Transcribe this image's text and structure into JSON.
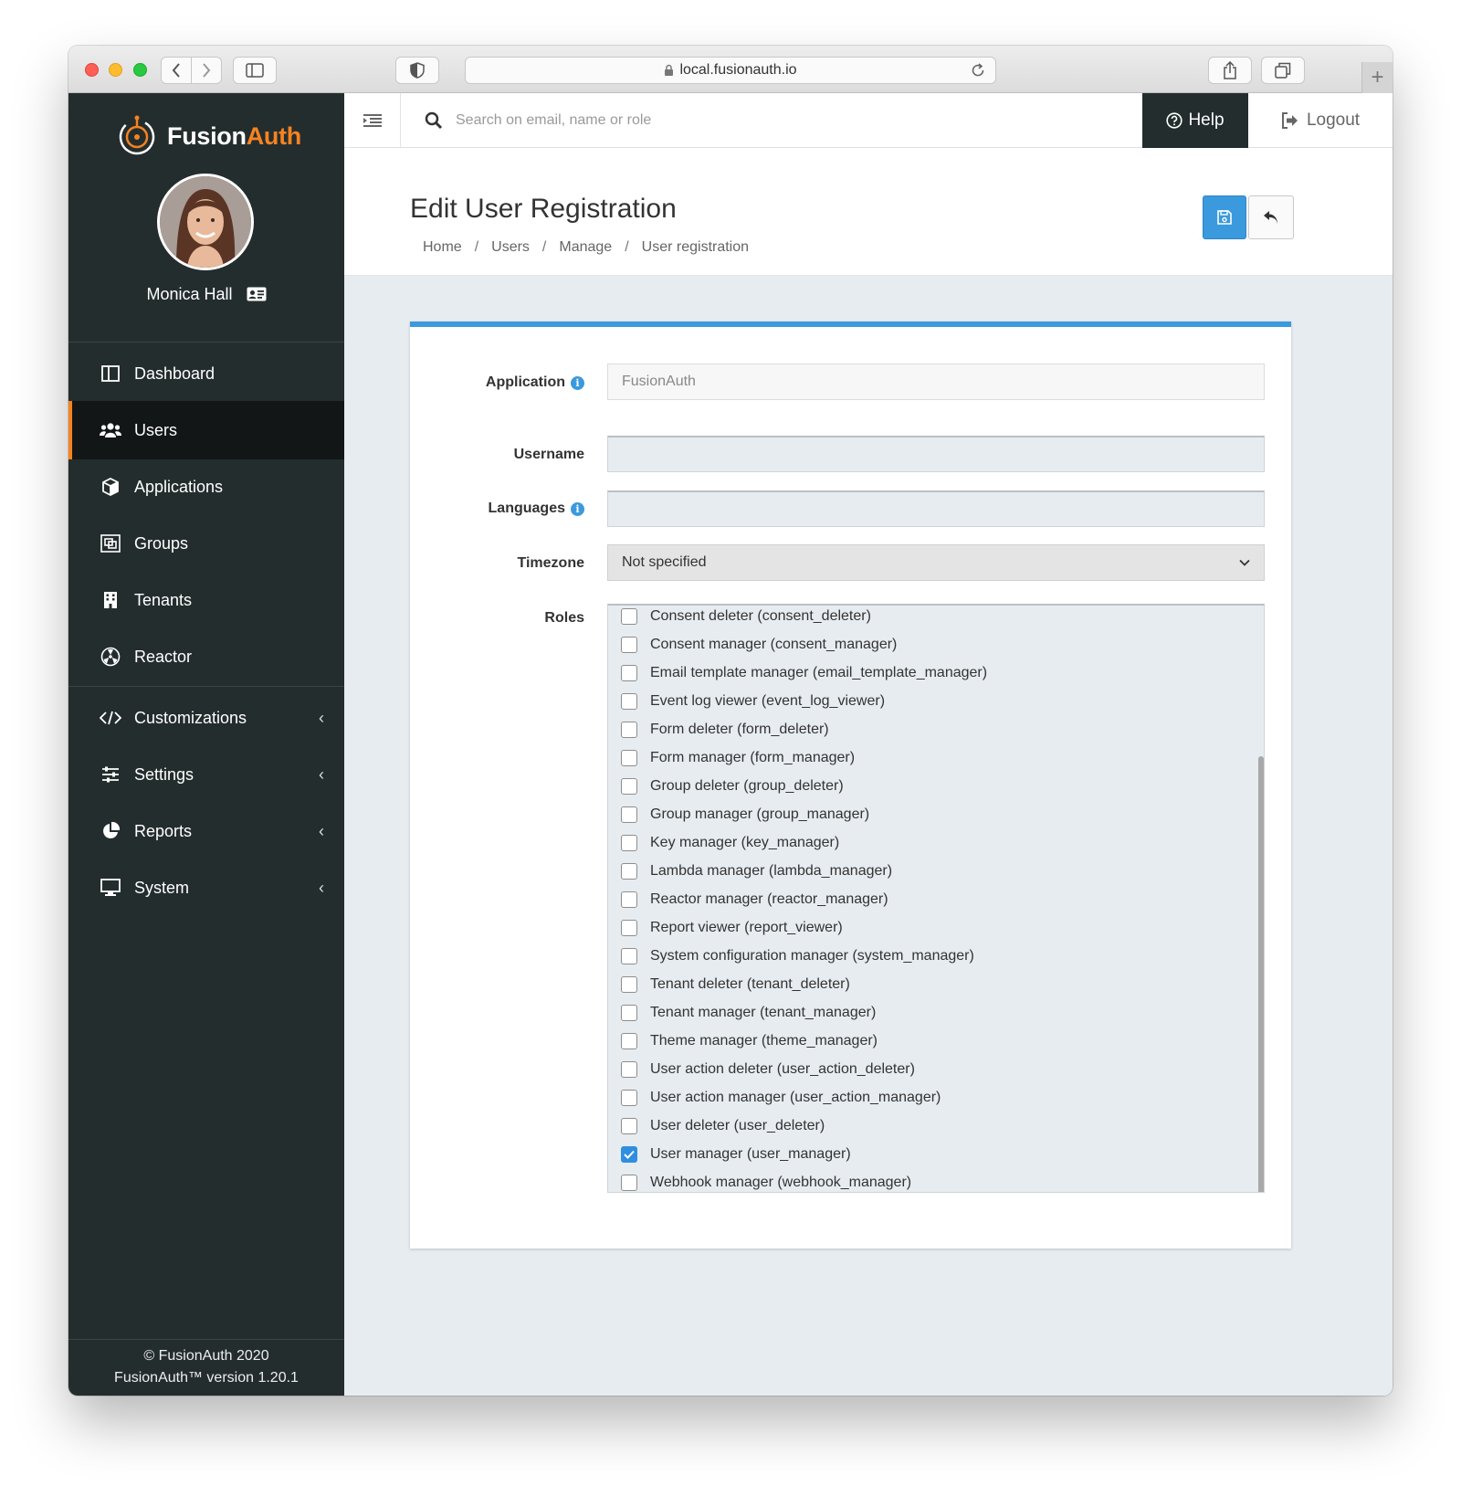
{
  "browser": {
    "url": "local.fusionauth.io"
  },
  "sidebar": {
    "brand_part1": "Fusion",
    "brand_part2": "Auth",
    "user_name": "Monica Hall",
    "items": [
      {
        "label": "Dashboard",
        "icon": "dashboard-icon"
      },
      {
        "label": "Users",
        "icon": "users-icon",
        "active": true
      },
      {
        "label": "Applications",
        "icon": "cube-icon"
      },
      {
        "label": "Groups",
        "icon": "groups-icon"
      },
      {
        "label": "Tenants",
        "icon": "building-icon"
      },
      {
        "label": "Reactor",
        "icon": "reactor-icon"
      },
      {
        "label": "Customizations",
        "icon": "code-icon",
        "expandable": true
      },
      {
        "label": "Settings",
        "icon": "sliders-icon",
        "expandable": true
      },
      {
        "label": "Reports",
        "icon": "pie-chart-icon",
        "expandable": true
      },
      {
        "label": "System",
        "icon": "desktop-icon",
        "expandable": true
      }
    ],
    "footer_line1": "© FusionAuth 2020",
    "footer_line2": "FusionAuth™ version 1.20.1"
  },
  "topbar": {
    "search_placeholder": "Search on email, name or role",
    "help_label": "Help",
    "logout_label": "Logout"
  },
  "header": {
    "title": "Edit User Registration",
    "breadcrumb": [
      "Home",
      "Users",
      "Manage",
      "User registration"
    ]
  },
  "form": {
    "application_label": "Application",
    "application_value": "FusionAuth",
    "username_label": "Username",
    "username_value": "",
    "languages_label": "Languages",
    "languages_value": "",
    "timezone_label": "Timezone",
    "timezone_value": "Not specified",
    "roles_label": "Roles",
    "roles": [
      {
        "label": "Consent deleter (consent_deleter)",
        "checked": false
      },
      {
        "label": "Consent manager (consent_manager)",
        "checked": false
      },
      {
        "label": "Email template manager (email_template_manager)",
        "checked": false
      },
      {
        "label": "Event log viewer (event_log_viewer)",
        "checked": false
      },
      {
        "label": "Form deleter (form_deleter)",
        "checked": false
      },
      {
        "label": "Form manager (form_manager)",
        "checked": false
      },
      {
        "label": "Group deleter (group_deleter)",
        "checked": false
      },
      {
        "label": "Group manager (group_manager)",
        "checked": false
      },
      {
        "label": "Key manager (key_manager)",
        "checked": false
      },
      {
        "label": "Lambda manager (lambda_manager)",
        "checked": false
      },
      {
        "label": "Reactor manager (reactor_manager)",
        "checked": false
      },
      {
        "label": "Report viewer (report_viewer)",
        "checked": false
      },
      {
        "label": "System configuration manager (system_manager)",
        "checked": false
      },
      {
        "label": "Tenant deleter (tenant_deleter)",
        "checked": false
      },
      {
        "label": "Tenant manager (tenant_manager)",
        "checked": false
      },
      {
        "label": "Theme manager (theme_manager)",
        "checked": false
      },
      {
        "label": "User action deleter (user_action_deleter)",
        "checked": false
      },
      {
        "label": "User action manager (user_action_manager)",
        "checked": false
      },
      {
        "label": "User deleter (user_deleter)",
        "checked": false
      },
      {
        "label": "User manager (user_manager)",
        "checked": true
      },
      {
        "label": "Webhook manager (webhook_manager)",
        "checked": false
      }
    ]
  },
  "colors": {
    "brand_orange": "#f58320",
    "primary_blue": "#3b99dd",
    "sidebar_bg": "#242d2e"
  }
}
